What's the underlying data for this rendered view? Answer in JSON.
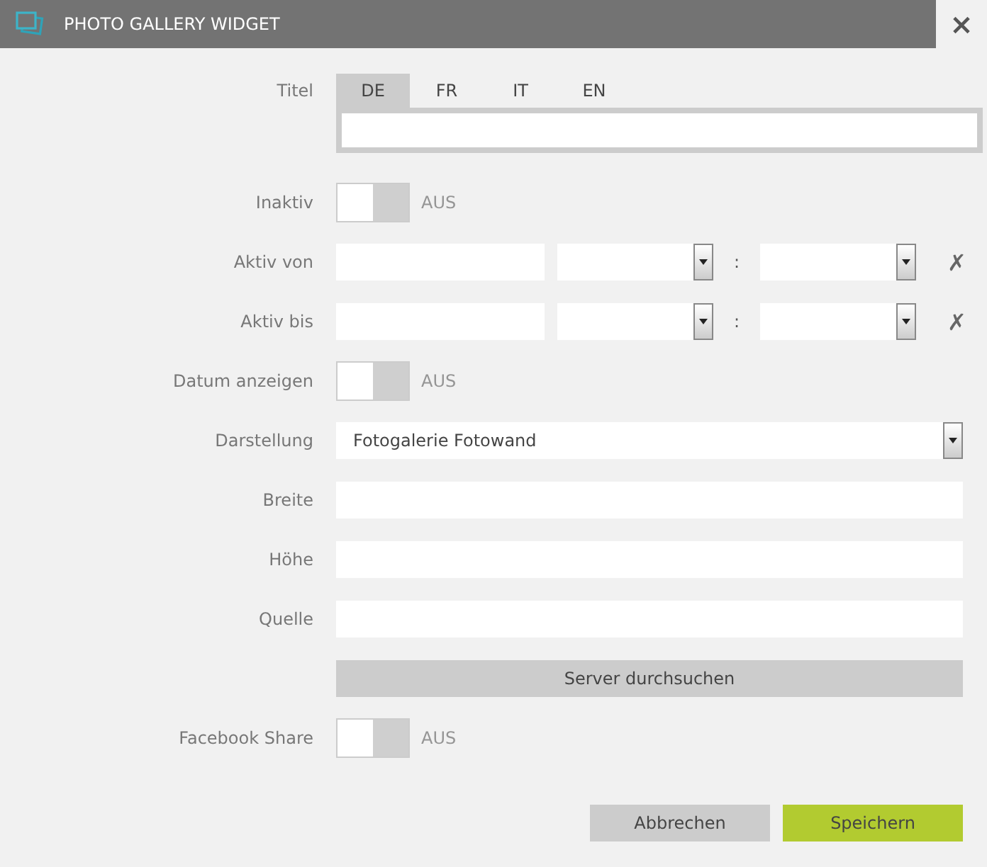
{
  "window": {
    "title": "PHOTO GALLERY WIDGET",
    "close": "×"
  },
  "fields": [
    {
      "kind": "lang",
      "label": "Titel",
      "tabs": [
        {
          "label": "DE",
          "selected": true
        },
        {
          "label": "FR",
          "selected": false
        },
        {
          "label": "IT",
          "selected": false
        },
        {
          "label": "EN",
          "selected": false
        }
      ]
    },
    {
      "kind": "toggle",
      "label": "Inaktiv",
      "on": false,
      "state": "AUS"
    },
    {
      "kind": "datetime",
      "label": "Aktiv von",
      "separator": ":",
      "clear": "✗"
    },
    {
      "kind": "datetime",
      "label": "Aktiv bis",
      "separator": ":",
      "clear": "✗"
    },
    {
      "kind": "toggle",
      "label": "Datum anzeigen",
      "on": false,
      "state": "AUS"
    },
    {
      "kind": "select",
      "label": "Darstellung",
      "value": "Fotogalerie Fotowand"
    },
    {
      "kind": "text",
      "label": "Breite"
    },
    {
      "kind": "text",
      "label": "Höhe"
    },
    {
      "kind": "text",
      "label": "Quelle"
    },
    {
      "kind": "button",
      "label": "Server durchsuchen"
    },
    {
      "kind": "toggle",
      "label": "Facebook Share",
      "on": false,
      "state": "AUS"
    }
  ],
  "buttons": [
    {
      "kind": "cancel",
      "label": "Abbrechen"
    },
    {
      "kind": "primary",
      "label": "Speichern"
    }
  ]
}
